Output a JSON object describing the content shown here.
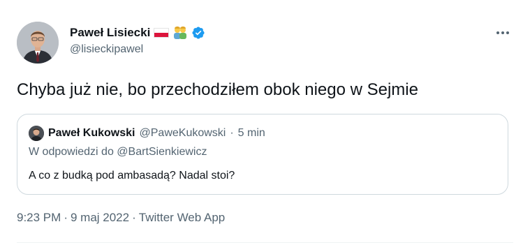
{
  "author": {
    "name": "Paweł Lisiecki",
    "handle": "@lisieckipawel",
    "badges": [
      "poland-flag-icon",
      "people-emoji-icon",
      "verified-badge-icon"
    ]
  },
  "tweet": {
    "text": "Chyba już nie, bo przechodziłem obok niego w Sejmie"
  },
  "quoted_tweet": {
    "name": "Paweł Kukowski",
    "handle": "@PaweKukowski",
    "separator": "·",
    "time_ago": "5 min",
    "reply_prefix": "W odpowiedzi do",
    "reply_to": "@BartSienkiewicz",
    "text": "A co z budką pod ambasadą? Nadal stoi?"
  },
  "footer": {
    "time": "9:23 PM",
    "date": "9 maj 2022",
    "source": "Twitter Web App",
    "separator": "·"
  },
  "colors": {
    "text_primary": "#0f1419",
    "text_secondary": "#536471",
    "border": "#cfd9de",
    "verified": "#1d9bf0"
  }
}
